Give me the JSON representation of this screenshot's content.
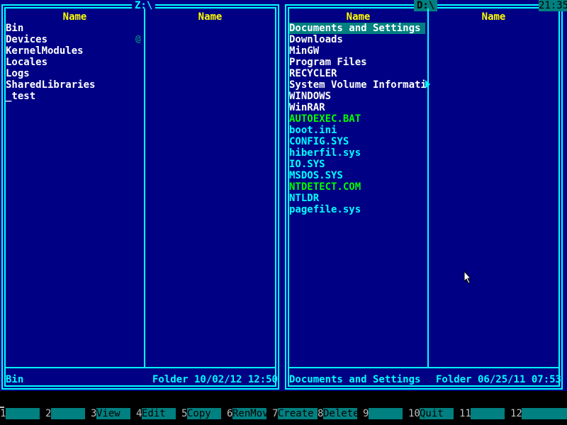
{
  "left_panel": {
    "path": "Z:\\",
    "column_headers": [
      "Name",
      "Name"
    ],
    "files": [
      {
        "name": "Bin",
        "type": "folder",
        "color": "#ffffff"
      },
      {
        "name": "Devices",
        "type": "folder",
        "color": "#ffffff"
      },
      {
        "name": "KernelModules",
        "type": "folder",
        "color": "#ffffff"
      },
      {
        "name": "Locales",
        "type": "folder",
        "color": "#ffffff"
      },
      {
        "name": "Logs",
        "type": "folder",
        "color": "#ffffff"
      },
      {
        "name": "SharedLibraries",
        "type": "folder",
        "color": "#ffffff"
      },
      {
        "name": "_test",
        "type": "folder",
        "color": "#ffffff"
      }
    ],
    "link_marker": "@",
    "status": {
      "name": "Bin",
      "info": "Folder 10/02/12 12:50"
    }
  },
  "right_panel": {
    "path": "D:\\",
    "column_headers": [
      "Name",
      "Name"
    ],
    "files": [
      {
        "name": "Documents and Settings",
        "type": "folder",
        "selected": true
      },
      {
        "name": "Downloads",
        "type": "folder"
      },
      {
        "name": "MinGW",
        "type": "folder"
      },
      {
        "name": "Program Files",
        "type": "folder"
      },
      {
        "name": "RECYCLER",
        "type": "folder"
      },
      {
        "name": "System Volume Informatio",
        "type": "folder"
      },
      {
        "name": "WINDOWS",
        "type": "folder"
      },
      {
        "name": "WinRAR",
        "type": "folder"
      },
      {
        "name": "AUTOEXEC.BAT",
        "type": "executable"
      },
      {
        "name": "boot.ini",
        "type": "file"
      },
      {
        "name": "CONFIG.SYS",
        "type": "file"
      },
      {
        "name": "hiberfil.sys",
        "type": "file"
      },
      {
        "name": "IO.SYS",
        "type": "file"
      },
      {
        "name": "MSDOS.SYS",
        "type": "file"
      },
      {
        "name": "NTDETECT.COM",
        "type": "executable"
      },
      {
        "name": "NTLDR",
        "type": "file"
      },
      {
        "name": "pagefile.sys",
        "type": "file"
      }
    ],
    "status": {
      "name": "Documents and Settings",
      "info": "Folder 06/25/11 07:53"
    }
  },
  "clock": "21:35",
  "keybar": [
    {
      "num": "1",
      "label": ""
    },
    {
      "num": "2",
      "label": ""
    },
    {
      "num": "3",
      "label": "View"
    },
    {
      "num": "4",
      "label": "Edit"
    },
    {
      "num": "5",
      "label": "Copy"
    },
    {
      "num": "6",
      "label": "RenMov"
    },
    {
      "num": "7",
      "label": "Create"
    },
    {
      "num": "8",
      "label": "Delete"
    },
    {
      "num": "9",
      "label": ""
    },
    {
      "num": "10",
      "label": "Quit"
    },
    {
      "num": "11",
      "label": ""
    },
    {
      "num": "12",
      "label": ""
    }
  ],
  "colors": {
    "panel_bg": "#000084",
    "border": "#00ffff",
    "header": "#ffff00",
    "folder": "#ffffff",
    "executable": "#00ff00",
    "file": "#00ffff",
    "selection": "#008080"
  }
}
